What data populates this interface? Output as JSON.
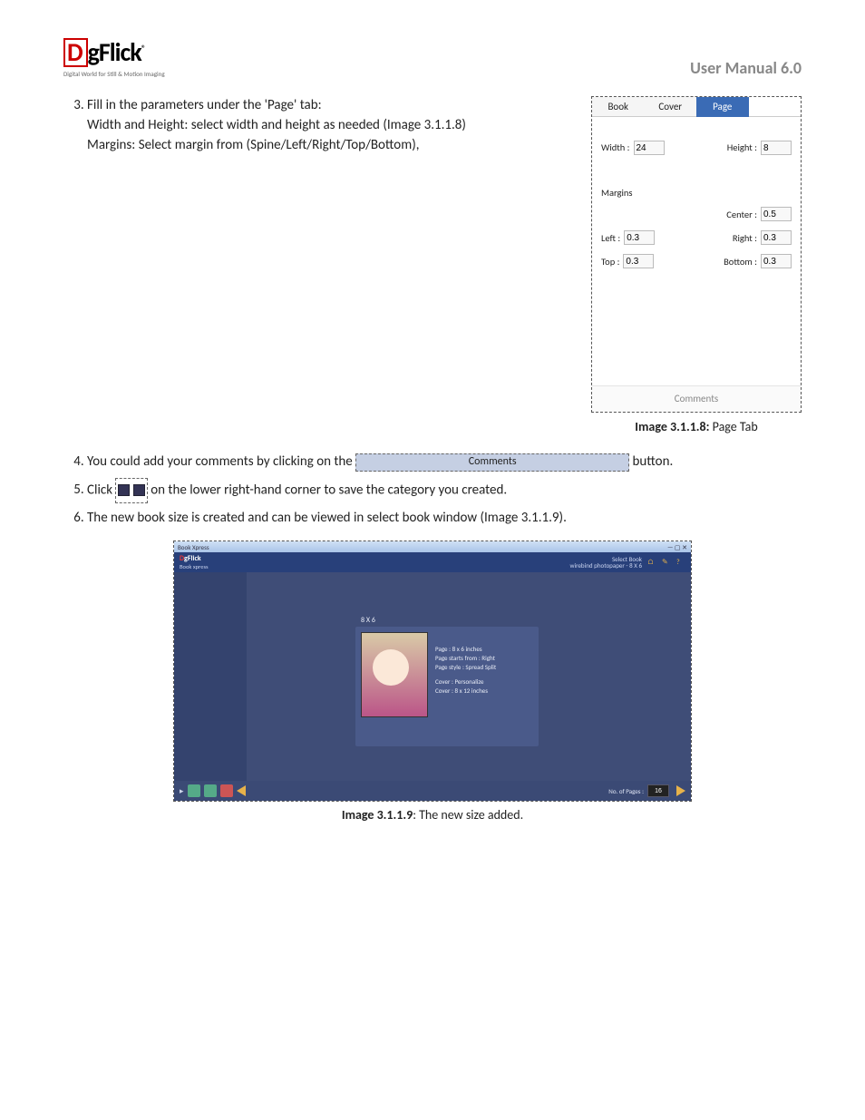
{
  "header": {
    "title": "User Manual 6.0"
  },
  "logo": {
    "tagline": "Digital World for Still & Motion Imaging"
  },
  "list": {
    "item3": {
      "l1": "Fill in the parameters under the 'Page' tab:",
      "l2": "Width and Height: select width and height as needed (Image 3.1.1.8)",
      "l3": "Margins: Select margin from (Spine/Left/Right/Top/Bottom),"
    },
    "item4_pre": "You could add your comments by clicking on the ",
    "item4_post": "button.",
    "item5_pre": "Click ",
    "item5_post": " on the lower right-hand corner to save the category you created.",
    "item6": "The new book size is created and can be viewed in select book window (Image 3.1.1.9)."
  },
  "ptab": {
    "tabs": {
      "book": "Book",
      "cover": "Cover",
      "page": "Page"
    },
    "width_label": "Width :",
    "width_val": "24",
    "height_label": "Height :",
    "height_val": "8",
    "margins_label": "Margins",
    "center_label": "Center :",
    "center_val": "0.5",
    "left_label": "Left :",
    "left_val": "0.3",
    "right_label": "Right :",
    "right_val": "0.3",
    "top_label": "Top :",
    "top_val": "0.3",
    "bottom_label": "Bottom :",
    "bottom_val": "0.3",
    "comments": "Comments"
  },
  "caption1": {
    "bold": "Image 3.1.1.8:",
    "rest": "  Page Tab"
  },
  "comments_btn": "Comments",
  "sb": {
    "titlebar_app": "Book Xpress",
    "logo_prefix": "D",
    "logo_rest": "gFlick",
    "logo_sub": "Book xpress",
    "header_right_t": "Select Book",
    "header_right_b": "wirebind photopaper - 8 X 6",
    "card_label": "8 X 6",
    "spec1": "Page : 8 x 6 inches",
    "spec2": "Page starts from : Right",
    "spec3": "Page style : Spread Split",
    "spec4": "Cover : Personalize",
    "spec5": "Cover : 8 x 12 inches",
    "pages_label": "No. of Pages :",
    "pages_val": "16"
  },
  "caption2": {
    "bold": "Image 3.1.1.9",
    "rest": ": The new size added."
  }
}
